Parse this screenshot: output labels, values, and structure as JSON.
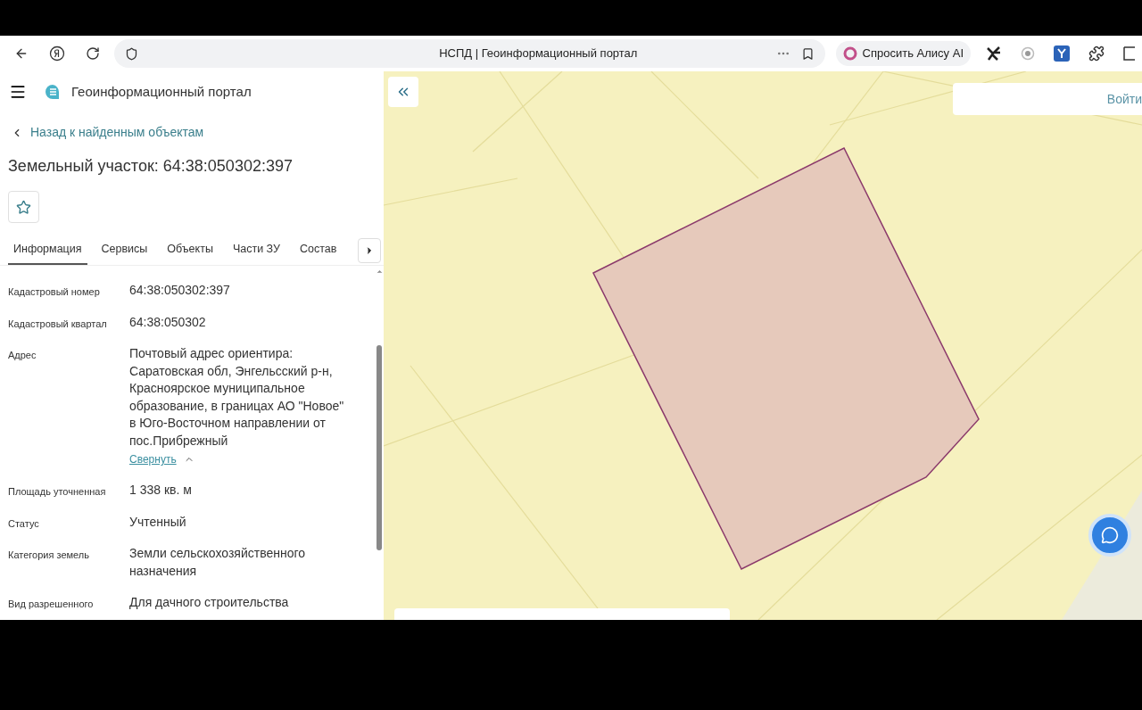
{
  "browser": {
    "page_title": "НСПД | Геоинформационный портал",
    "alice_button": "Спросить Алису AI"
  },
  "portal": {
    "title": "Геоинформационный портал",
    "back_link": "Назад к найденным объектам",
    "heading": "Земельный участок: 64:38:050302:397",
    "favorite": false
  },
  "tabs": [
    {
      "label": "Информация",
      "selected": true
    },
    {
      "label": "Сервисы",
      "selected": false
    },
    {
      "label": "Объекты",
      "selected": false
    },
    {
      "label": "Части ЗУ",
      "selected": false
    },
    {
      "label": "Состав",
      "selected": false
    }
  ],
  "fields": [
    {
      "label": "Кадастровый номер",
      "lines": [
        "64:38:050302:397"
      ]
    },
    {
      "label": "Кадастровый квартал",
      "lines": [
        "64:38:050302"
      ]
    },
    {
      "label": "Адрес",
      "lines": [
        "Почтовый адрес ориентира:",
        "Саратовская обл, Энгельсский р-н,",
        "Красноярское муниципальное",
        "образование, в границах АО \"Новое\"",
        "в Юго-Восточном направлении от",
        "пос.Прибрежный"
      ],
      "collapse_link": "Свернуть"
    },
    {
      "label": "Площадь уточненная",
      "lines": [
        "1 338 кв. м"
      ]
    },
    {
      "label": "Статус",
      "lines": [
        "Учтенный"
      ]
    },
    {
      "label": "Категория земель",
      "lines": [
        "Земли сельскохозяйственного",
        "назначения"
      ]
    },
    {
      "label": "Вид разрешенного",
      "lines": [
        "Для дачного строительства"
      ]
    }
  ],
  "map": {
    "login_button": "Войти"
  }
}
